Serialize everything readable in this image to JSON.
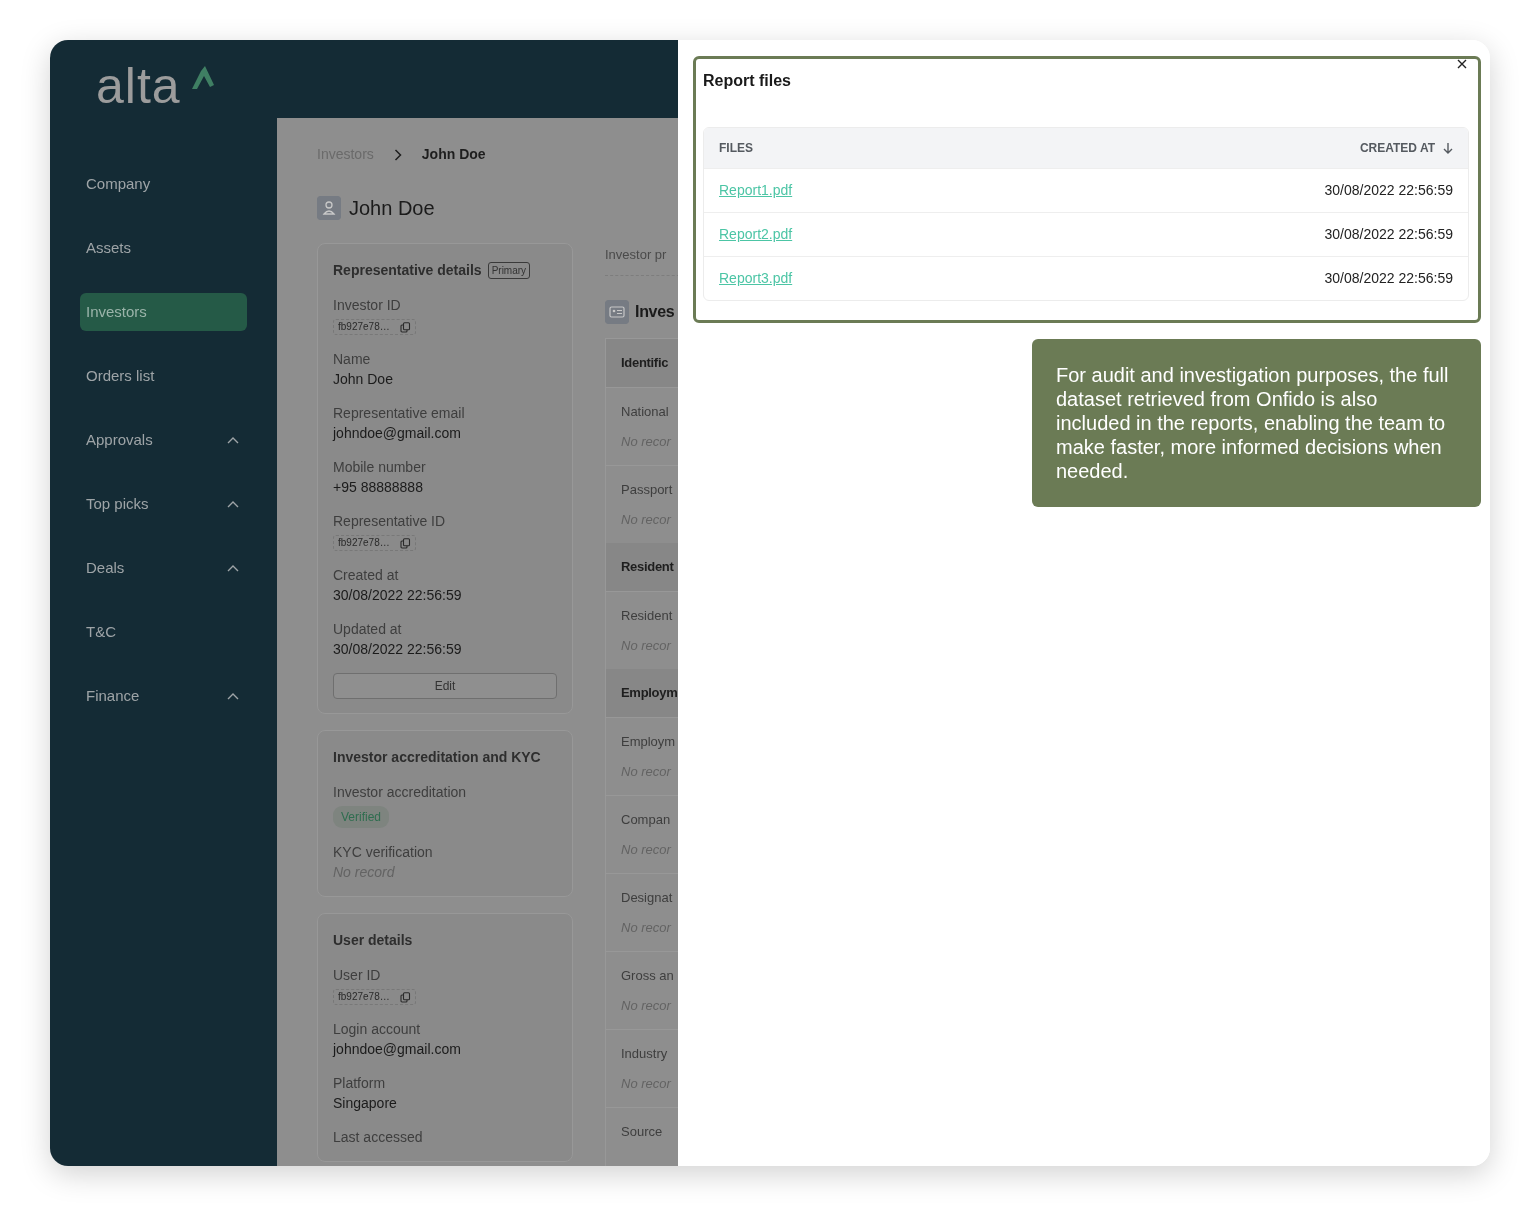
{
  "logo": "alta",
  "sidebar": {
    "items": [
      {
        "label": "Company",
        "kind": "link",
        "selected": false
      },
      {
        "label": "Assets",
        "kind": "link",
        "selected": false
      },
      {
        "label": "Investors",
        "kind": "link",
        "selected": true
      },
      {
        "label": "Orders list",
        "kind": "link",
        "selected": false
      },
      {
        "label": "Approvals",
        "kind": "group",
        "selected": false
      },
      {
        "label": "Top picks",
        "kind": "group",
        "selected": false
      },
      {
        "label": "Deals",
        "kind": "group",
        "selected": false
      },
      {
        "label": "T&C",
        "kind": "link",
        "selected": false
      },
      {
        "label": "Finance",
        "kind": "group",
        "selected": false
      }
    ]
  },
  "breadcrumb": [
    {
      "label": "Investors",
      "current": false
    },
    {
      "label": "John Doe",
      "current": true
    }
  ],
  "page_title": "John Doe",
  "cards": [
    {
      "title": "Representative details",
      "badge": "Primary",
      "button": "Edit",
      "fields": [
        {
          "label": "Investor ID",
          "value": "fb927e78…",
          "kind": "id"
        },
        {
          "label": "Name",
          "value": "John Doe",
          "kind": "text"
        },
        {
          "label": "Representative email",
          "value": "johndoe@gmail.com",
          "kind": "text"
        },
        {
          "label": "Mobile number",
          "value": "+95 88888888",
          "kind": "text"
        },
        {
          "label": "Representative ID",
          "value": "fb927e78…",
          "kind": "id"
        },
        {
          "label": "Created at",
          "value": "30/08/2022 22:56:59",
          "kind": "text"
        },
        {
          "label": "Updated at",
          "value": "30/08/2022 22:56:59",
          "kind": "text"
        }
      ]
    },
    {
      "title": "Investor accreditation and KYC",
      "fields": [
        {
          "label": "Investor accreditation",
          "value": "Verified",
          "kind": "status"
        },
        {
          "label": "KYC verification",
          "value": "No record",
          "kind": "empty"
        }
      ]
    },
    {
      "title": "User details",
      "fields": [
        {
          "label": "User ID",
          "value": "fb927e78…",
          "kind": "id"
        },
        {
          "label": "Login account",
          "value": "johndoe@gmail.com",
          "kind": "text"
        },
        {
          "label": "Platform",
          "value": "Singapore",
          "kind": "text"
        },
        {
          "label": "Last accessed"
        }
      ]
    }
  ],
  "investor_panel": {
    "tab": "Investor pr",
    "title": "Inves",
    "sections": [
      {
        "heading": "Identific",
        "rows": [
          {
            "label": "National",
            "value": "No recor"
          },
          {
            "label": "Passport",
            "value": "No recor"
          }
        ]
      },
      {
        "heading": "Resident",
        "rows": [
          {
            "label": "Resident",
            "value": "No recor"
          }
        ]
      },
      {
        "heading": "Employm",
        "rows": [
          {
            "label": "Employm",
            "value": "No recor"
          },
          {
            "label": "Compan",
            "value": "No recor"
          },
          {
            "label": "Designat",
            "value": "No recor"
          },
          {
            "label": "Gross an",
            "value": "No recor"
          },
          {
            "label": "Industry",
            "value": "No recor"
          },
          {
            "label": "Source"
          }
        ]
      }
    ]
  },
  "report_files": {
    "title": "Report files",
    "columns": [
      {
        "label": "FILES",
        "sorted": false
      },
      {
        "label": "CREATED AT",
        "sorted": true
      }
    ],
    "rows": [
      {
        "file": "Report1.pdf",
        "created_at": "30/08/2022 22:56:59"
      },
      {
        "file": "Report2.pdf",
        "created_at": "30/08/2022 22:56:59"
      },
      {
        "file": "Report3.pdf",
        "created_at": "30/08/2022 22:56:59"
      }
    ]
  },
  "callout": "For audit and investigation purposes, the full dataset retrieved from Onfido is also included in the reports, enabling the team to make faster, more informed decisions when needed."
}
